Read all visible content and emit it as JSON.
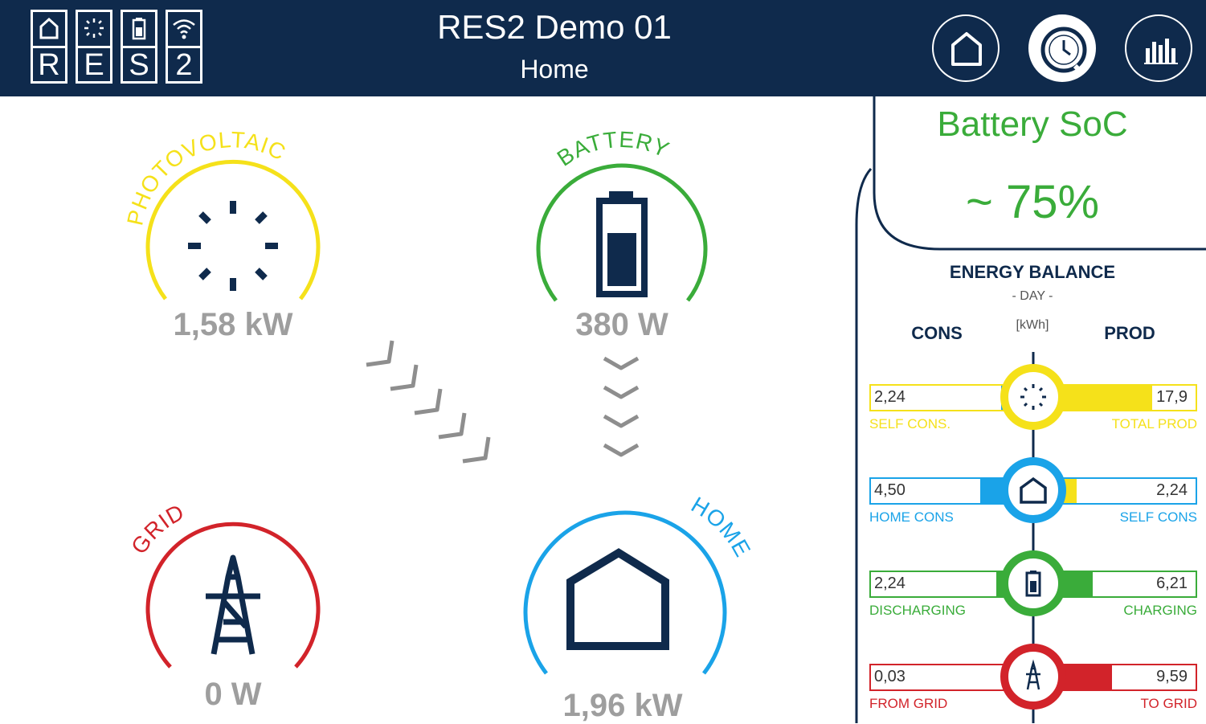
{
  "header": {
    "title": "RES2 Demo 01",
    "subtitle": "Home",
    "logo_letters": [
      "R",
      "E",
      "S",
      "2"
    ]
  },
  "nav": [
    {
      "icon": "home-icon",
      "active": false
    },
    {
      "icon": "clock-icon",
      "active": true
    },
    {
      "icon": "bar-chart-icon",
      "active": false
    }
  ],
  "gauges": {
    "photovoltaic": {
      "label": "PHOTOVOLTAIC",
      "value": "1,58 kW",
      "color": "#f5e11a",
      "icon": "sun-icon"
    },
    "battery": {
      "label": "BATTERY",
      "value": "380 W",
      "color": "#3aac3a",
      "icon": "battery-icon"
    },
    "grid": {
      "label": "GRID",
      "value": "0 W",
      "color": "#d2232a",
      "icon": "power-tower-icon"
    },
    "home": {
      "label": "HOME",
      "value": "1,96 kW",
      "color": "#1aa3e8",
      "icon": "house-icon"
    }
  },
  "flows": {
    "pv_to_home_arrow": "arrow-chevrons-icon",
    "battery_to_home_arrow": "arrow-chevrons-icon"
  },
  "soc": {
    "label": "Battery SoC",
    "value": "~ 75%"
  },
  "energy_balance": {
    "title": "ENERGY BALANCE",
    "period": "- DAY -",
    "unit": "[kWh]",
    "cons_header": "CONS",
    "prod_header": "PROD",
    "rows": [
      {
        "color": "#f5e11a",
        "icon": "sun-icon",
        "left_value": "2,24",
        "left_label": "SELF CONS.",
        "left_fill_color": "#1aa3e8",
        "right_value": "17,9",
        "right_label": "TOTAL PROD",
        "right_fill_color": "#f5e11a"
      },
      {
        "color": "#1aa3e8",
        "icon": "house-icon",
        "left_value": "4,50",
        "left_label": "HOME CONS",
        "left_fill_color": "#1aa3e8",
        "right_value": "2,24",
        "right_label": "SELF CONS",
        "right_fill_color": "#f5e11a"
      },
      {
        "color": "#3aac3a",
        "icon": "battery-icon",
        "left_value": "2,24",
        "left_label": "DISCHARGING",
        "left_fill_color": "#3aac3a",
        "right_value": "6,21",
        "right_label": "CHARGING",
        "right_fill_color": "#3aac3a"
      },
      {
        "color": "#d2232a",
        "icon": "power-tower-icon",
        "left_value": "0,03",
        "left_label": "FROM GRID",
        "left_fill_color": "#d2232a",
        "right_value": "9,59",
        "right_label": "TO GRID",
        "right_fill_color": "#d2232a"
      }
    ]
  }
}
